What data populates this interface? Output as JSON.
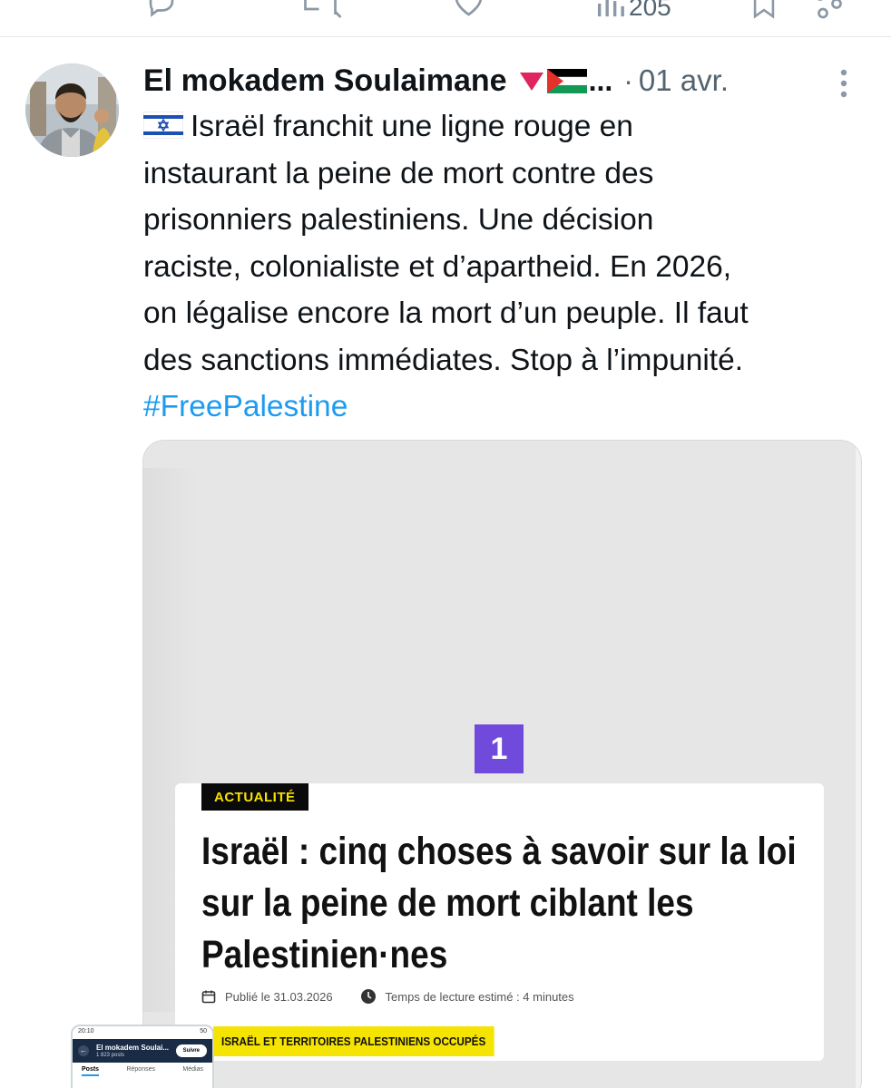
{
  "previous_tweet": {
    "views_count": "205",
    "icons": [
      "reply-icon",
      "retweet-icon",
      "like-icon",
      "views-icon",
      "bookmark-icon",
      "share-icon"
    ]
  },
  "tweet": {
    "author_name": "El mokadem Soulaimane",
    "name_suffix": "...",
    "separator": "·",
    "date": "01 avr.",
    "text_lines": [
      "Israël franchit une ligne rouge en",
      "instaurant la peine de mort contre des",
      "prisonniers palestiniens. Une décision",
      "raciste, colonialiste et d’apartheid. En 2026,",
      "on légalise encore la mort d’un peuple. Il faut",
      "des sanctions immédiates. Stop à l’impunité."
    ],
    "hashtag": "#FreePalestine"
  },
  "media": {
    "badge_number": "1",
    "badge_color": "#6f4adb",
    "article": {
      "tag": "ACTUALITÉ",
      "headline_lines": [
        "Israël : cinq choses à savoir sur la loi",
        "sur la peine de mort ciblant les",
        "Palestinien·nes"
      ],
      "published": "Publié le 31.03.2026",
      "reading_time": "Temps de lecture estimé : 4 minutes",
      "region_tag": "ISRAËL ET TERRITOIRES PALESTINIENS OCCUPÉS",
      "region_tag_color": "#f5e300"
    }
  },
  "thumbnail": {
    "status_time": "20:10",
    "status_battery": "50",
    "profile_name": "El mokadem Soulai...",
    "posts_count": "1 823 posts",
    "follow_label": "Suivre",
    "tabs": [
      "Posts",
      "Réponses",
      "Médias"
    ]
  },
  "colors": {
    "link": "#1d9bf0",
    "muted_text": "#536471",
    "text": "#0f1419"
  }
}
